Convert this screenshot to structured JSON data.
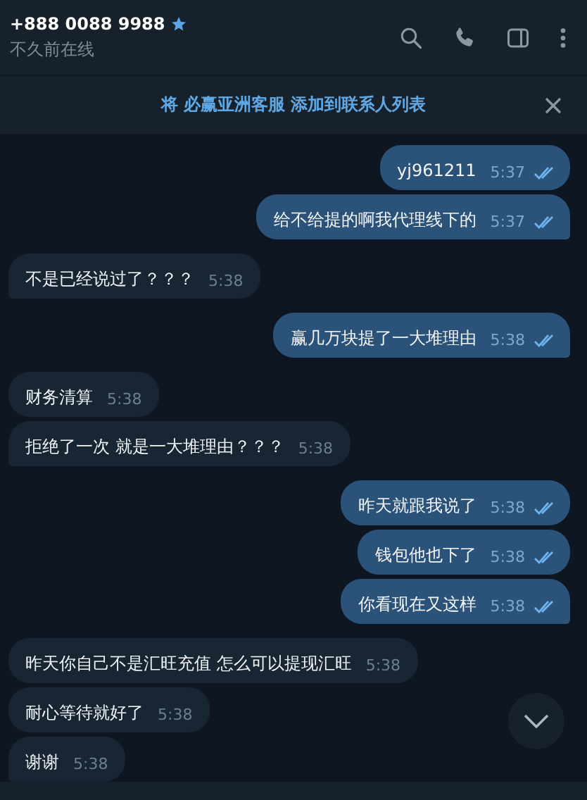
{
  "header": {
    "title": "+888 0088 9988",
    "starred": true,
    "status": "不久前在线"
  },
  "banner": {
    "text": "将 必赢亚洲客服 添加到联系人列表"
  },
  "messages": [
    {
      "kind": "out",
      "text": "yj961211",
      "time": "5:37",
      "read": true
    },
    {
      "kind": "out",
      "text": "给不给提的啊我代理线下的",
      "time": "5:37",
      "read": true
    },
    {
      "kind": "in",
      "text": "不是已经说过了？？？",
      "time": "5:38"
    },
    {
      "kind": "out",
      "text": "赢几万块提了一大堆理由",
      "time": "5:38",
      "read": true
    },
    {
      "kind": "in",
      "text": "财务清算",
      "time": "5:38"
    },
    {
      "kind": "in",
      "text": "拒绝了一次 就是一大堆理由？？？",
      "time": "5:38"
    },
    {
      "kind": "out",
      "text": "昨天就跟我说了",
      "time": "5:38",
      "read": true
    },
    {
      "kind": "out",
      "text": "钱包他也下了",
      "time": "5:38",
      "read": true
    },
    {
      "kind": "out",
      "text": "你看现在又这样",
      "time": "5:38",
      "read": true
    },
    {
      "kind": "in",
      "text": "昨天你自己不是汇旺充值 怎么可以提现汇旺",
      "time": "5:38"
    },
    {
      "kind": "in",
      "text": "耐心等待就好了",
      "time": "5:38"
    },
    {
      "kind": "in",
      "text": "谢谢",
      "time": "5:38"
    }
  ]
}
